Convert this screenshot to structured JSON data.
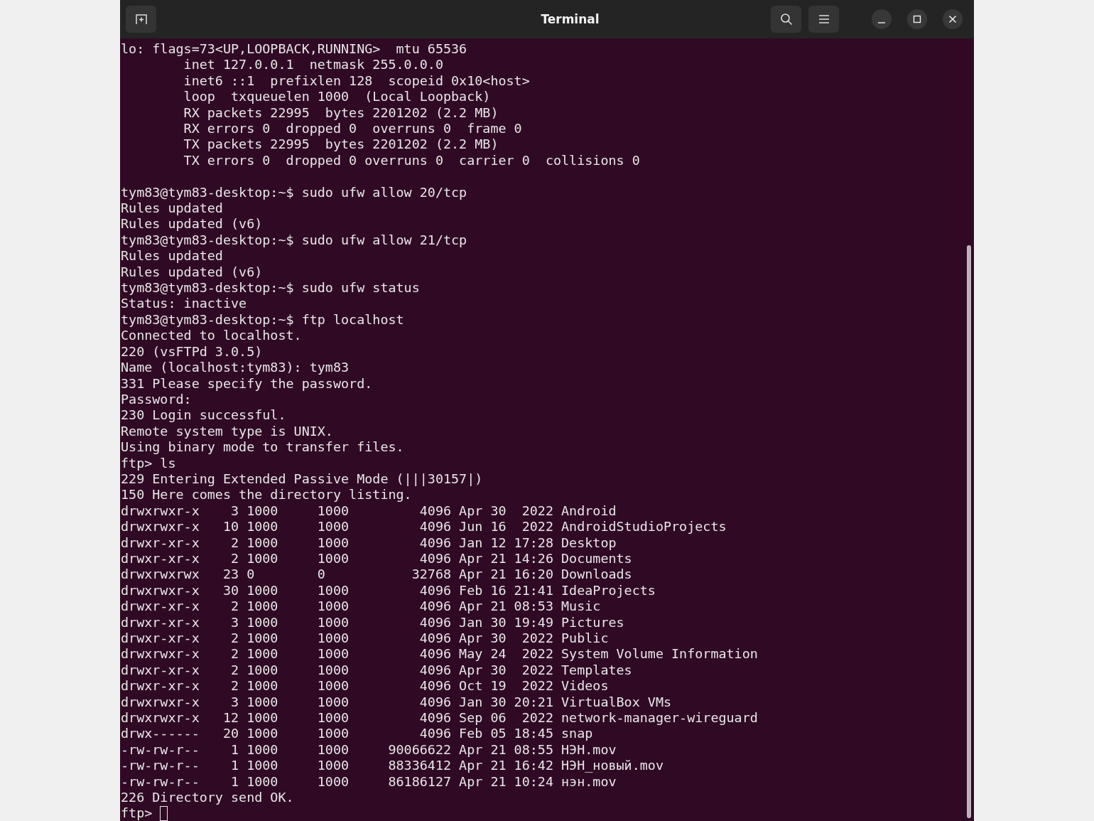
{
  "window": {
    "title": "Terminal"
  },
  "output_blocks": [
    {
      "lines": [
        "lo: flags=73<UP,LOOPBACK,RUNNING>  mtu 65536",
        "        inet 127.0.0.1  netmask 255.0.0.0",
        "        inet6 ::1  prefixlen 128  scopeid 0x10<host>",
        "        loop  txqueuelen 1000  (Local Loopback)",
        "        RX packets 22995  bytes 2201202 (2.2 MB)",
        "        RX errors 0  dropped 0  overruns 0  frame 0",
        "        TX packets 22995  bytes 2201202 (2.2 MB)",
        "        TX errors 0  dropped 0 overruns 0  carrier 0  collisions 0"
      ]
    },
    {
      "lines": [
        "tym83@tym83-desktop:~$ sudo ufw allow 20/tcp",
        "Rules updated",
        "Rules updated (v6)",
        "tym83@tym83-desktop:~$ sudo ufw allow 21/tcp",
        "Rules updated",
        "Rules updated (v6)",
        "tym83@tym83-desktop:~$ sudo ufw status",
        "Status: inactive",
        "tym83@tym83-desktop:~$ ftp localhost",
        "Connected to localhost.",
        "220 (vsFTPd 3.0.5)",
        "Name (localhost:tym83): tym83",
        "331 Please specify the password.",
        "Password:",
        "230 Login successful.",
        "Remote system type is UNIX.",
        "Using binary mode to transfer files.",
        "ftp> ls",
        "229 Entering Extended Passive Mode (|||30157|)",
        "150 Here comes the directory listing.",
        "drwxrwxr-x    3 1000     1000         4096 Apr 30  2022 Android",
        "drwxrwxr-x   10 1000     1000         4096 Jun 16  2022 AndroidStudioProjects",
        "drwxr-xr-x    2 1000     1000         4096 Jan 12 17:28 Desktop",
        "drwxr-xr-x    2 1000     1000         4096 Apr 21 14:26 Documents",
        "drwxrwxrwx   23 0        0           32768 Apr 21 16:20 Downloads",
        "drwxrwxr-x   30 1000     1000         4096 Feb 16 21:41 IdeaProjects",
        "drwxr-xr-x    2 1000     1000         4096 Apr 21 08:53 Music",
        "drwxr-xr-x    3 1000     1000         4096 Jan 30 19:49 Pictures",
        "drwxr-xr-x    2 1000     1000         4096 Apr 30  2022 Public",
        "drwxrwxr-x    2 1000     1000         4096 May 24  2022 System Volume Information",
        "drwxr-xr-x    2 1000     1000         4096 Apr 30  2022 Templates",
        "drwxr-xr-x    2 1000     1000         4096 Oct 19  2022 Videos",
        "drwxrwxr-x    3 1000     1000         4096 Jan 30 20:21 VirtualBox VMs",
        "drwxrwxr-x   12 1000     1000         4096 Sep 06  2022 network-manager-wireguard",
        "drwx------   20 1000     1000         4096 Feb 05 18:45 snap",
        "-rw-rw-r--    1 1000     1000     90066622 Apr 21 08:55 НЭН.mov",
        "-rw-rw-r--    1 1000     1000     88336412 Apr 21 16:42 НЭН_новый.mov",
        "-rw-rw-r--    1 1000     1000     86186127 Apr 21 10:24 нэн.mov",
        "226 Directory send OK."
      ]
    }
  ],
  "prompt": "ftp>"
}
